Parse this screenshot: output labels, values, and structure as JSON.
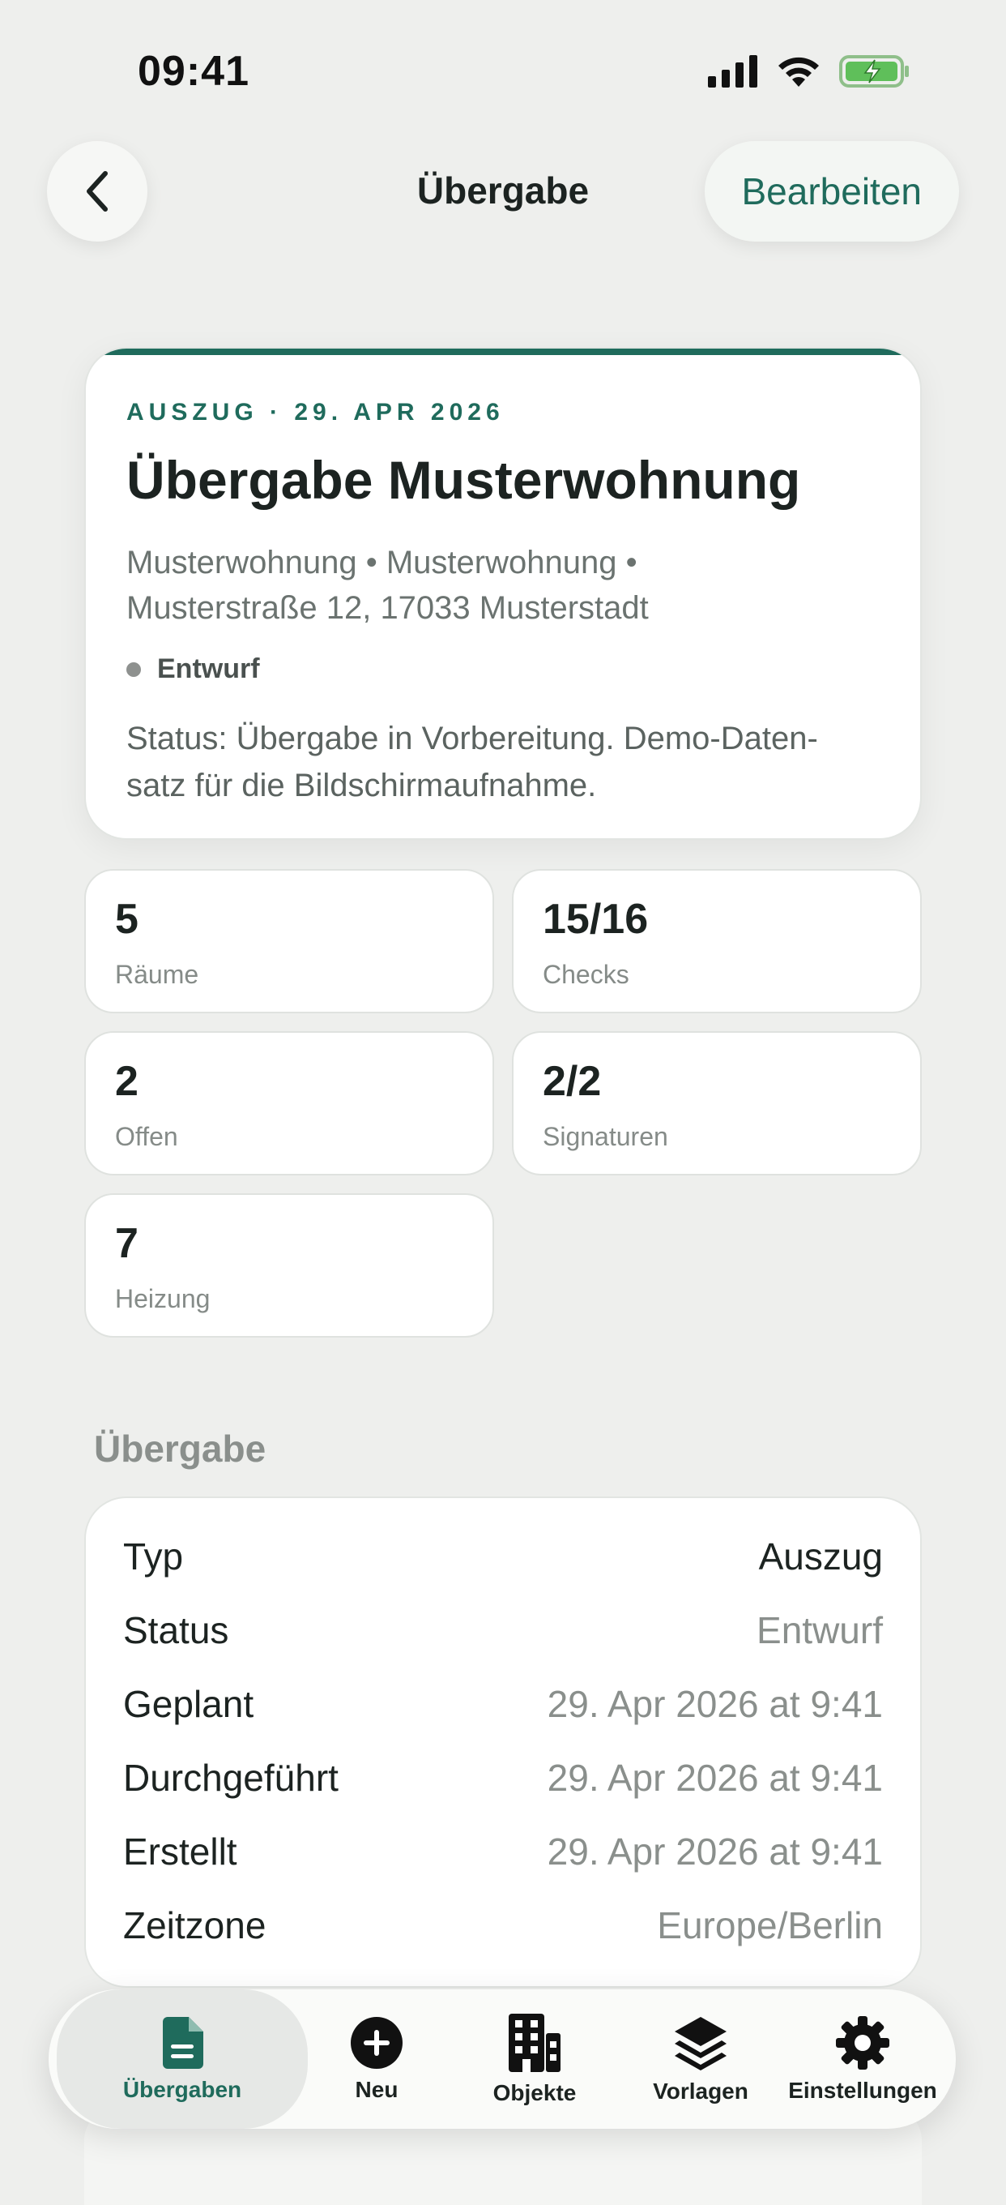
{
  "status_bar": {
    "time": "09:41"
  },
  "nav": {
    "title": "Übergabe",
    "edit_label": "Bearbeiten"
  },
  "hero": {
    "eyebrow": "AUSZUG · 29. APR 2026",
    "title": "Übergabe Musterwohnung",
    "address_line1": "Musterwohnung • Musterwohnung •",
    "address_line2": "Musterstraße 12, 17033 Musterstadt",
    "badge": "Entwurf",
    "description_line1": "Status: Übergabe in Vorbereitung. Demo-Daten-",
    "description_line2": "satz für die Bildschirmaufnahme."
  },
  "stats": [
    {
      "value": "5",
      "label": "Räume"
    },
    {
      "value": "15/16",
      "label": "Checks"
    },
    {
      "value": "2",
      "label": "Offen"
    },
    {
      "value": "2/2",
      "label": "Signaturen"
    },
    {
      "value": "7",
      "label": "Heizung"
    }
  ],
  "section": {
    "title": "Übergabe",
    "rows": [
      {
        "key": "Typ",
        "value": "Auszug"
      },
      {
        "key": "Status",
        "value": "Entwurf"
      },
      {
        "key": "Geplant",
        "value": "29. Apr 2026 at 9:41"
      },
      {
        "key": "Durchgeführt",
        "value": "29. Apr 2026 at 9:41"
      },
      {
        "key": "Erstellt",
        "value": "29. Apr 2026 at 9:41"
      },
      {
        "key": "Zeitzone",
        "value": "Europe/Berlin"
      }
    ]
  },
  "tabs": [
    {
      "label": "Übergaben",
      "icon": "document-icon",
      "active": true
    },
    {
      "label": "Neu",
      "icon": "plus-circle-icon"
    },
    {
      "label": "Objekte",
      "icon": "building-icon"
    },
    {
      "label": "Vorlagen",
      "icon": "layers-icon"
    },
    {
      "label": "Einstellungen",
      "icon": "gear-icon"
    }
  ],
  "colors": {
    "accent": "#1f6b5c",
    "background": "#eeefed",
    "muted": "#8a8f8c"
  }
}
